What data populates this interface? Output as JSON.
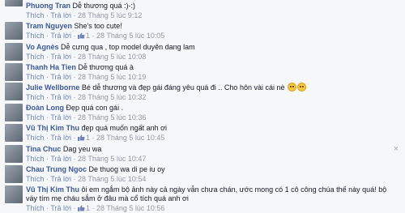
{
  "actions": {
    "like_label": "Thích",
    "reply_label": "Trả lời",
    "dot": "·"
  },
  "comments": [
    {
      "name": "Phuong Tran",
      "text": "Dễ thương quá :)-:)",
      "likes": "",
      "time": "28 Tháng 5 lúc 9:12"
    },
    {
      "name": "Tram Nguyen",
      "text": "She's too cute!",
      "likes": "1",
      "time": "28 Tháng 5 lúc 10:05"
    },
    {
      "name": "Vo Agnès",
      "text": "Dễ cưng qua , top model duyên dang lam",
      "likes": "",
      "time": "28 Tháng 5 lúc 10:08"
    },
    {
      "name": "Thanh Ha Tien",
      "text": "Dễ thương quá à",
      "likes": "",
      "time": "28 Tháng 5 lúc 10:19"
    },
    {
      "name": "Julie Wellborne",
      "text": "Bé dễ thương và đẹp gái đáng yêu quá đi .. Cho hôn vài cái nè",
      "likes": "",
      "time": "28 Tháng 5 lúc 10:32"
    },
    {
      "name": "Đoàn Long",
      "text": "Đẹp quá con gái .",
      "likes": "",
      "time": "28 Tháng 5 lúc 10:36"
    },
    {
      "name": "Vũ Thị Kim Thu",
      "text": "đẹp quá muốn ngất anh ơi",
      "likes": "1",
      "time": "28 Tháng 5 lúc 10:45"
    },
    {
      "name": "Tina Chuc",
      "text": "Dag yeu wa",
      "likes": "",
      "time": "28 Tháng 5 lúc 10:47"
    },
    {
      "name": "Chau Trung Ngoc",
      "text": "De thuog wa di pe iu oy",
      "likes": "",
      "time": "28 Tháng 5 lúc 10:54"
    },
    {
      "name": "Vũ Thị Kim Thu",
      "text": "ôi em ngắm bộ ảnh này cả ngày vẫn chưa chán, ước mong có 1 cô công chúa thế này quá! bộ váy tím mẹ cháu sắm ở đâu mà cổ tích quá anh ơi",
      "likes": "1",
      "time": "28 Tháng 5 lúc 10:56"
    }
  ],
  "close_glyph": "×",
  "colors": {
    "name": "#3b5998",
    "meta": "#9197a3",
    "link": "#6d84b4",
    "background": "#f6f7f9"
  }
}
